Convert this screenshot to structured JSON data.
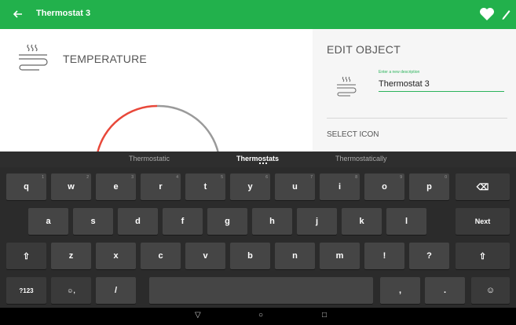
{
  "appbar": {
    "title": "Thermostat 3",
    "back_icon": "arrow-left-icon",
    "favorite_icon": "heart-icon",
    "edit_icon": "pencil-icon",
    "color": "#22b14c"
  },
  "left": {
    "label": "TEMPERATURE",
    "icon": "heat-waves-icon",
    "gauge_colors": [
      "#e8483a",
      "#9a9a9a"
    ]
  },
  "right": {
    "title": "EDIT OBJECT",
    "description_hint": "Enter a new description",
    "description_value": "Thermostat 3",
    "select_icon_label": "SELECT ICON",
    "accent": "#2bb35b"
  },
  "keyboard": {
    "suggestions": [
      "Thermostatic",
      "Thermostats",
      "Thermostatically"
    ],
    "row1": [
      {
        "label": "q",
        "hint": "1"
      },
      {
        "label": "w",
        "hint": "2"
      },
      {
        "label": "e",
        "hint": "3"
      },
      {
        "label": "r",
        "hint": "4"
      },
      {
        "label": "t",
        "hint": "5"
      },
      {
        "label": "y",
        "hint": "6"
      },
      {
        "label": "u",
        "hint": "7"
      },
      {
        "label": "i",
        "hint": "8"
      },
      {
        "label": "o",
        "hint": "9"
      },
      {
        "label": "p",
        "hint": "0"
      }
    ],
    "row1_back": "⌫",
    "row2": [
      "a",
      "s",
      "d",
      "f",
      "g",
      "h",
      "j",
      "k",
      "l"
    ],
    "row2_next": "Next",
    "row3": [
      "⇧",
      "z",
      "x",
      "c",
      "v",
      "b",
      "n",
      "m",
      "!",
      "?",
      "⇧"
    ],
    "row4": [
      "?123",
      "☺,",
      "/",
      "",
      ",",
      ".",
      "☺"
    ],
    "nav": {
      "back": "▽",
      "home": "○",
      "recent": "□"
    }
  }
}
